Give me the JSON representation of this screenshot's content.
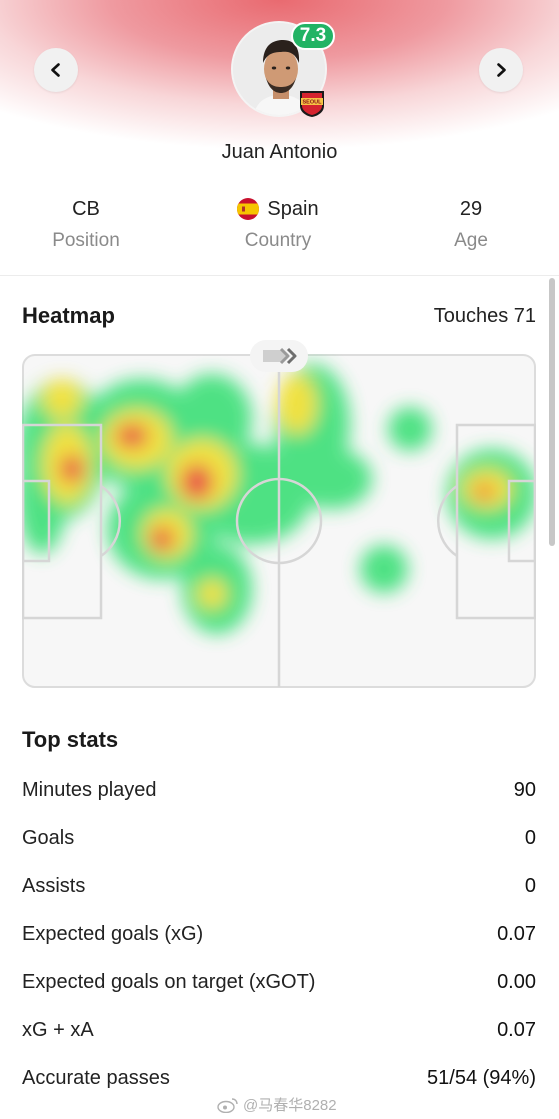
{
  "player": {
    "name": "Juan Antonio",
    "rating": "7.3",
    "club_badge_text": "SEOUL",
    "rating_color": "#22b364"
  },
  "info": {
    "position": {
      "value": "CB",
      "label": "Position"
    },
    "country": {
      "value": "Spain",
      "label": "Country",
      "flag": "spain-flag"
    },
    "age": {
      "value": "29",
      "label": "Age"
    }
  },
  "heatmap": {
    "title": "Heatmap",
    "touches_label": "Touches 71"
  },
  "top_stats": {
    "title": "Top stats",
    "rows": [
      {
        "label": "Minutes played",
        "value": "90"
      },
      {
        "label": "Goals",
        "value": "0"
      },
      {
        "label": "Assists",
        "value": "0"
      },
      {
        "label": "Expected goals (xG)",
        "value": "0.07"
      },
      {
        "label": "Expected goals on target (xGOT)",
        "value": "0.00"
      },
      {
        "label": "xG + xA",
        "value": "0.07"
      },
      {
        "label": "Accurate passes",
        "value": "51/54 (94%)"
      }
    ]
  },
  "watermark": "@马春华8282",
  "colors": {
    "hero_accent": "#e96a70",
    "heat_low": "#3fe07a",
    "heat_mid": "#f0e030",
    "heat_high": "#e8413a"
  }
}
